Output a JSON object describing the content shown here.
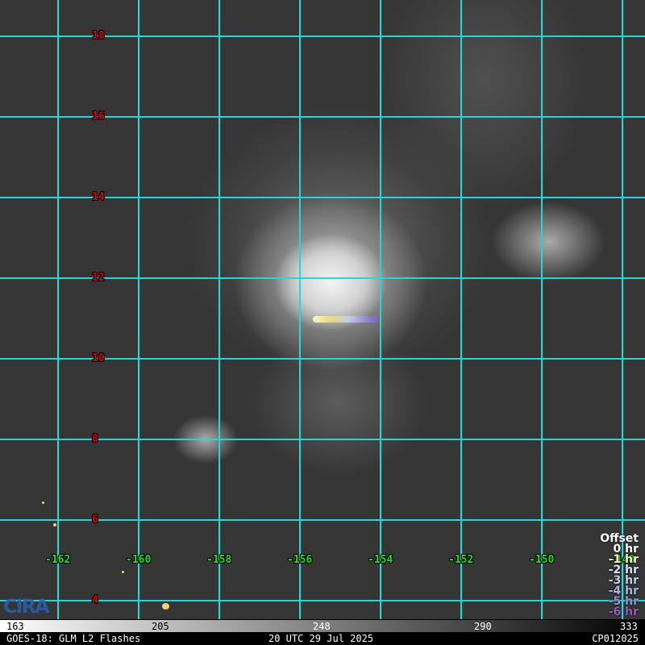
{
  "map": {
    "latitudes": [
      "18",
      "16",
      "14",
      "12",
      "10",
      "8",
      "6",
      "4"
    ],
    "longitudes": [
      "-162",
      "-160",
      "-158",
      "-156",
      "-154",
      "-152",
      "-150",
      "-148"
    ],
    "grid_color": "#20d8d8"
  },
  "legend": {
    "title": "Offset",
    "items": [
      {
        "label": "0 hr",
        "color": "#fffff0"
      },
      {
        "label": "-1 hr",
        "color": "#f5f0c0"
      },
      {
        "label": "-2 hr",
        "color": "#d8e4f0"
      },
      {
        "label": "-3 hr",
        "color": "#bcd0e8"
      },
      {
        "label": "-4 hr",
        "color": "#a4b8e0"
      },
      {
        "label": "-5 hr",
        "color": "#9090d0"
      },
      {
        "label": "-6 hr",
        "color": "#9060b8"
      }
    ]
  },
  "scale": {
    "ticks": [
      "163",
      "205",
      "248",
      "290",
      "333"
    ]
  },
  "footer": {
    "left": "GOES-18: GLM L2 Flashes",
    "center": "20 UTC 29 Jul 2025",
    "right": "CP012025"
  },
  "logo": "CIRA"
}
